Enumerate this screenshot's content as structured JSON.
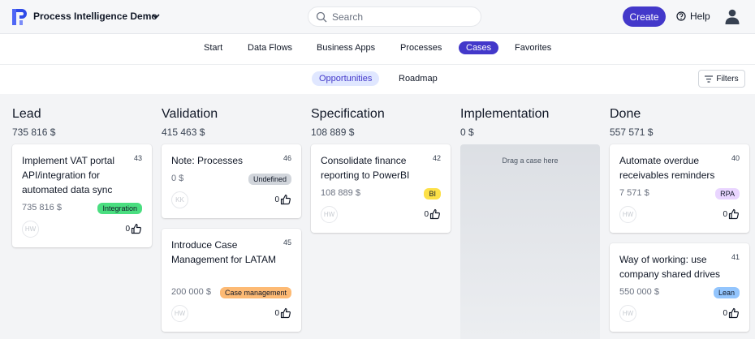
{
  "header": {
    "app_title": "Process Intelligence Demo",
    "search_placeholder": "Search",
    "create_label": "Create",
    "help_label": "Help"
  },
  "nav": {
    "items": [
      "Start",
      "Data Flows",
      "Business Apps",
      "Processes",
      "Cases",
      "Favorites"
    ],
    "active": "Cases"
  },
  "subnav": {
    "items": [
      "Opportunities",
      "Roadmap"
    ],
    "active": "Opportunities",
    "filters_label": "Filters"
  },
  "board": {
    "columns": [
      {
        "title": "Lead",
        "total": "735 816 $"
      },
      {
        "title": "Validation",
        "total": "415 463 $"
      },
      {
        "title": "Specification",
        "total": "108 889 $"
      },
      {
        "title": "Implementation",
        "total": "0 $",
        "empty_text": "Drag a case here"
      },
      {
        "title": "Done",
        "total": "557 571 $"
      }
    ],
    "cards": [
      {
        "title": "Implement VAT portal API/integration for automated data sync",
        "number": "43",
        "amount": "735 816 $",
        "tag": "Integration",
        "tag_color": "#4ade80",
        "avatar": "HW",
        "likes": "0"
      },
      {
        "title": "Note: Processes",
        "number": "46",
        "amount": "0 $",
        "tag": "Undefined",
        "tag_color": "#d1d5db",
        "avatar": "KK",
        "likes": "0"
      },
      {
        "title": "Introduce Case Management for LATAM",
        "number": "45",
        "amount": "200 000 $",
        "tag": "Case management",
        "tag_color": "#fdba74",
        "avatar": "HW",
        "likes": "0"
      },
      {
        "title": "Consolidate finance reporting to PowerBI",
        "number": "42",
        "amount": "108 889 $",
        "tag": "BI",
        "tag_color": "#fde047",
        "avatar": "HW",
        "likes": "0"
      },
      {
        "title": "Automate overdue receivables reminders",
        "number": "40",
        "amount": "7 571 $",
        "tag": "RPA",
        "tag_color": "#e9d5ff",
        "avatar": "HW",
        "likes": "0"
      },
      {
        "title": "Way of working: use company shared drives",
        "number": "41",
        "amount": "550 000 $",
        "tag": "Lean",
        "tag_color": "#93c5fd",
        "avatar": "HW",
        "likes": "0"
      }
    ]
  }
}
